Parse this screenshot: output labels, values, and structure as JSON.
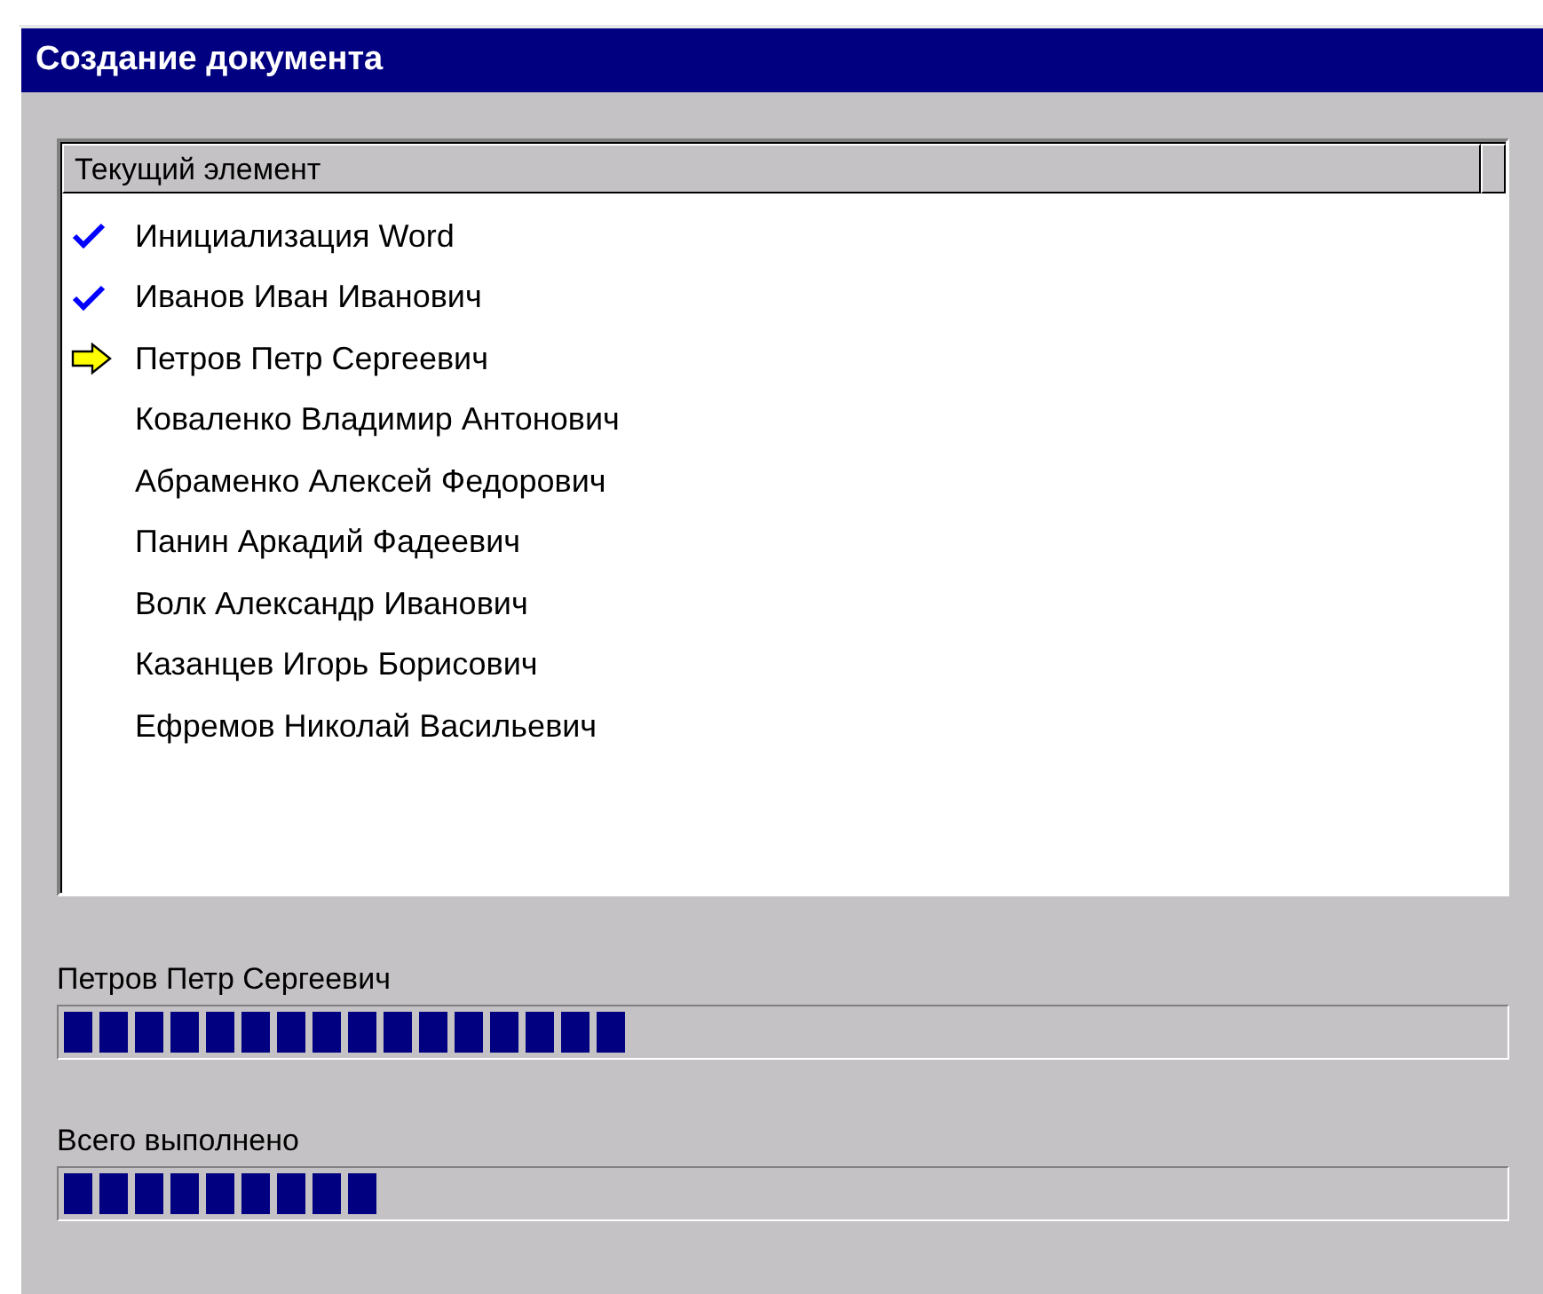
{
  "window": {
    "title": "Создание документа"
  },
  "list": {
    "columns": [
      "Текущий элемент"
    ],
    "items": [
      {
        "text": "Инициализация Word",
        "kind": "done"
      },
      {
        "text": "Иванов Иван Иванович",
        "kind": "done"
      },
      {
        "text": "Петров Петр Сергеевич",
        "kind": "current"
      },
      {
        "text": "Коваленко Владимир Антонович",
        "kind": "pending"
      },
      {
        "text": "Абраменко Алексей Федорович",
        "kind": "pending"
      },
      {
        "text": "Панин Аркадий Фадеевич",
        "kind": "pending"
      },
      {
        "text": "Волк Александр Иванович",
        "kind": "pending"
      },
      {
        "text": "Казанцев Игорь Борисович",
        "kind": "pending"
      },
      {
        "text": "Ефремов Николай Васильевич",
        "kind": "pending"
      }
    ]
  },
  "progress": [
    {
      "label": "Петров Петр Сергеевич",
      "level": 0.39
    },
    {
      "label": "Всего выполнено",
      "level": 0.22
    }
  ]
}
